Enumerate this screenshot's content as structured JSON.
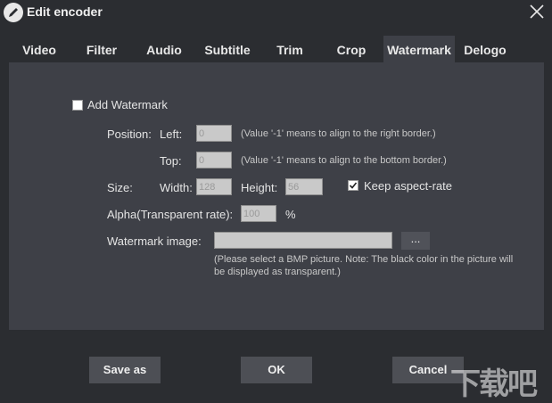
{
  "window": {
    "title": "Edit encoder"
  },
  "tabs": [
    {
      "label": "Video"
    },
    {
      "label": "Filter"
    },
    {
      "label": "Audio"
    },
    {
      "label": "Subtitle"
    },
    {
      "label": "Trim"
    },
    {
      "label": "Crop"
    },
    {
      "label": "Watermark",
      "active": true
    },
    {
      "label": "Delogo"
    }
  ],
  "watermark": {
    "add_label": "Add Watermark",
    "add_checked": false,
    "position_label": "Position:",
    "left_label": "Left:",
    "left_value": "0",
    "left_note": "(Value '-1' means to align to the right border.)",
    "top_label": "Top:",
    "top_value": "0",
    "top_note": "(Value '-1' means to align to the bottom border.)",
    "size_label": "Size:",
    "width_label": "Width:",
    "width_value": "128",
    "height_label": "Height:",
    "height_value": "56",
    "keep_aspect_label": "Keep aspect-rate",
    "keep_aspect_checked": true,
    "alpha_label": "Alpha(Transparent rate):",
    "alpha_value": "100",
    "alpha_unit": "%",
    "image_label": "Watermark image:",
    "image_value": "",
    "browse_label": "...",
    "image_note": "(Please select a BMP picture. Note: The black color in the picture will be displayed as transparent.)"
  },
  "buttons": {
    "save_as": "Save as",
    "ok": "OK",
    "cancel": "Cancel"
  },
  "site_watermark": {
    "text": "下载吧"
  },
  "colors": {
    "background": "#2b2d31",
    "panel": "#3e4047",
    "button": "#4d4f55"
  }
}
